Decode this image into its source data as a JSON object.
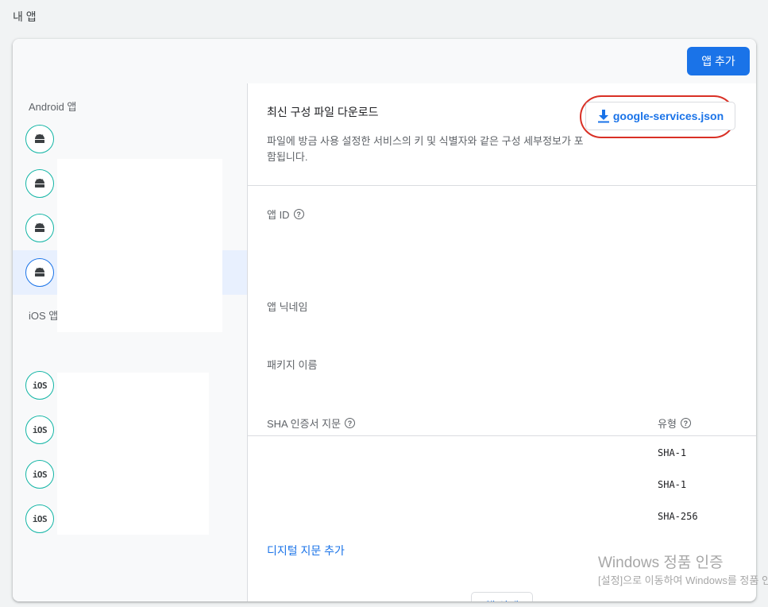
{
  "page": {
    "title": "내 앱"
  },
  "header": {
    "add_app_label": "앱 추가"
  },
  "sidebar": {
    "android_label": "Android 앱",
    "ios_label": "iOS 앱",
    "android_apps_count": 4,
    "ios_apps_count": 4,
    "selected_android_index": 3,
    "ios_icon_text": "iOS"
  },
  "config": {
    "title": "최신 구성 파일 다운로드",
    "description": "파일에 방금 사용 설정한 서비스의 키 및 식별자와 같은 구성 세부정보가 포함됩니다.",
    "download_label": "google-services.json"
  },
  "fields": {
    "app_id": "앱 ID",
    "nickname": "앱 닉네임",
    "package_name": "패키지 이름"
  },
  "sha": {
    "header": "SHA 인증서 지문",
    "type_header": "유형",
    "types": [
      "SHA-1",
      "SHA-1",
      "SHA-256"
    ],
    "add_fingerprint": "디지털 지문 추가"
  },
  "actions": {
    "delete_label": "앱 삭제"
  },
  "watermark": {
    "title": "Windows 정품 인증",
    "subtitle": "[설정]으로 이동하여 Windows를 정품 인증합니다."
  },
  "colors": {
    "accent": "#1a73e8",
    "highlight": "#d93025",
    "icon_ring": "#12b5a5"
  }
}
